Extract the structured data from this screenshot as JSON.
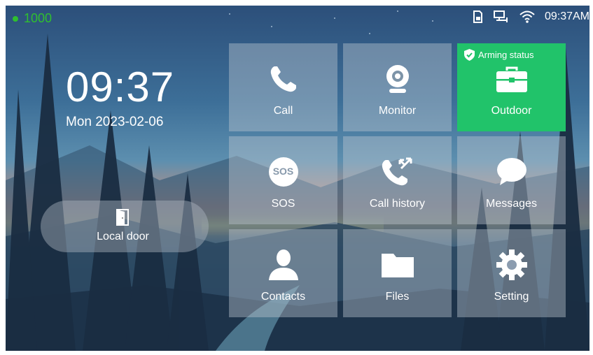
{
  "status": {
    "extension": "1000",
    "time": "09:37AM",
    "icons": [
      "sd-card-icon",
      "network-icon",
      "wifi-icon"
    ]
  },
  "clock": {
    "time": "09:37",
    "date": "Mon 2023-02-06"
  },
  "local_door": {
    "label": "Local door",
    "icon": "door-icon"
  },
  "tiles": [
    {
      "label": "Call",
      "icon": "phone-icon"
    },
    {
      "label": "Monitor",
      "icon": "camera-icon"
    },
    {
      "label": "Outdoor",
      "icon": "briefcase-icon",
      "badge": "Arming status",
      "badge_icon": "shield-check-icon",
      "color": "#21c36a"
    },
    {
      "label": "SOS",
      "icon": "sos-icon",
      "icon_text": "SOS"
    },
    {
      "label": "Call history",
      "icon": "call-history-icon"
    },
    {
      "label": "Messages",
      "icon": "message-bubble-icon"
    },
    {
      "label": "Contacts",
      "icon": "person-icon"
    },
    {
      "label": "Files",
      "icon": "folder-icon"
    },
    {
      "label": "Setting",
      "icon": "gear-icon"
    }
  ],
  "colors": {
    "extension_green": "#2fbf2f",
    "arming_green": "#21c36a"
  }
}
